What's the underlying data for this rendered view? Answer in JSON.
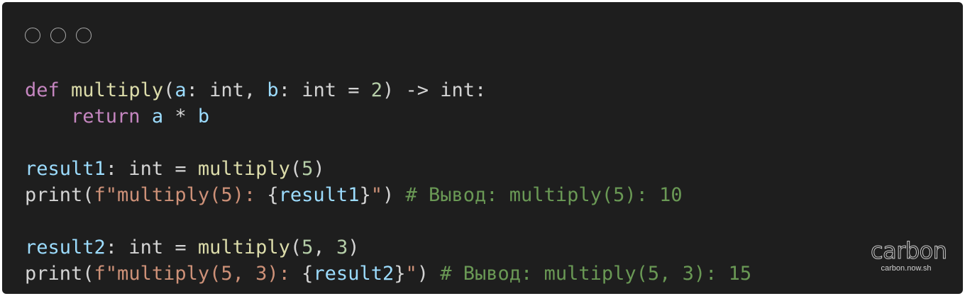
{
  "window": {
    "controls": [
      "close",
      "minimize",
      "maximize"
    ]
  },
  "code": {
    "lines": [
      [
        {
          "t": "def",
          "c": "kw"
        },
        {
          "t": " ",
          "c": "pl"
        },
        {
          "t": "multiply",
          "c": "fn"
        },
        {
          "t": "(",
          "c": "pl"
        },
        {
          "t": "a",
          "c": "var"
        },
        {
          "t": ": int, ",
          "c": "pl"
        },
        {
          "t": "b",
          "c": "var"
        },
        {
          "t": ": int = ",
          "c": "pl"
        },
        {
          "t": "2",
          "c": "num"
        },
        {
          "t": ") -> int:",
          "c": "pl"
        }
      ],
      [
        {
          "t": "    ",
          "c": "pl"
        },
        {
          "t": "return",
          "c": "kw"
        },
        {
          "t": " ",
          "c": "pl"
        },
        {
          "t": "a",
          "c": "var"
        },
        {
          "t": " * ",
          "c": "pl"
        },
        {
          "t": "b",
          "c": "var"
        }
      ],
      [],
      [
        {
          "t": "result1",
          "c": "var"
        },
        {
          "t": ": int = ",
          "c": "pl"
        },
        {
          "t": "multiply",
          "c": "fn"
        },
        {
          "t": "(",
          "c": "pl"
        },
        {
          "t": "5",
          "c": "num"
        },
        {
          "t": ")",
          "c": "pl"
        }
      ],
      [
        {
          "t": "print",
          "c": "pl"
        },
        {
          "t": "(",
          "c": "pl"
        },
        {
          "t": "f\"multiply(5): ",
          "c": "str"
        },
        {
          "t": "{",
          "c": "pl"
        },
        {
          "t": "result1",
          "c": "var"
        },
        {
          "t": "}",
          "c": "pl"
        },
        {
          "t": "\"",
          "c": "str"
        },
        {
          "t": ") ",
          "c": "pl"
        },
        {
          "t": "# Вывод: multiply(5): 10",
          "c": "cmt"
        }
      ],
      [],
      [
        {
          "t": "result2",
          "c": "var"
        },
        {
          "t": ": int = ",
          "c": "pl"
        },
        {
          "t": "multiply",
          "c": "fn"
        },
        {
          "t": "(",
          "c": "pl"
        },
        {
          "t": "5",
          "c": "num"
        },
        {
          "t": ", ",
          "c": "pl"
        },
        {
          "t": "3",
          "c": "num"
        },
        {
          "t": ")",
          "c": "pl"
        }
      ],
      [
        {
          "t": "print",
          "c": "pl"
        },
        {
          "t": "(",
          "c": "pl"
        },
        {
          "t": "f\"multiply(5, 3): ",
          "c": "str"
        },
        {
          "t": "{",
          "c": "pl"
        },
        {
          "t": "result2",
          "c": "var"
        },
        {
          "t": "}",
          "c": "pl"
        },
        {
          "t": "\"",
          "c": "str"
        },
        {
          "t": ") ",
          "c": "pl"
        },
        {
          "t": "# Вывод: multiply(5, 3): 15",
          "c": "cmt"
        }
      ]
    ]
  },
  "branding": {
    "logo": "carbon",
    "url": "carbon.now.sh"
  },
  "colors": {
    "background": "#1e1e1e",
    "keyword": "#c586c0",
    "function": "#dcdcaa",
    "variable": "#9cdcfe",
    "number": "#b5cea8",
    "string": "#ce9178",
    "comment": "#6a9955",
    "plain": "#d4d4d4"
  }
}
